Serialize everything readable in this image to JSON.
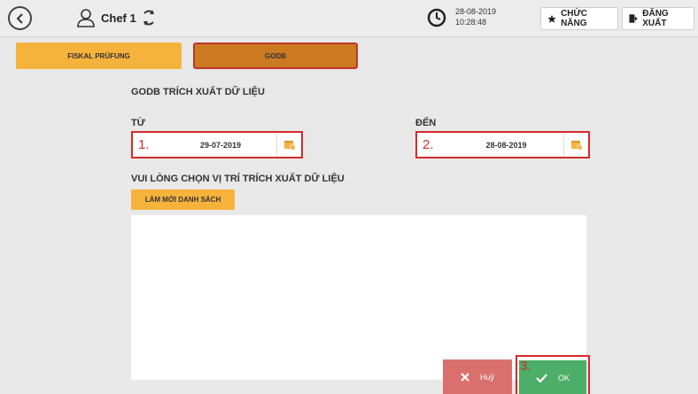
{
  "header": {
    "user_name": "Chef 1",
    "date": "28-08-2019",
    "time": "10:28:48",
    "functions_label": "CHỨC NĂNG",
    "logout_label": "ĐĂNG XUẤT"
  },
  "tabs": [
    {
      "label": "FISKAL PRÜFUNG",
      "active": false
    },
    {
      "label": "GODB",
      "active": true
    }
  ],
  "main": {
    "title": "GODB TRÍCH XUẤT DỮ LIỆU",
    "from_label": "TỪ",
    "to_label": "ĐẾN",
    "from_marker": "1.",
    "from_value": "29-07-2019",
    "to_marker": "2.",
    "to_value": "28-08-2019",
    "location_label": "VUI LÒNG CHỌN VỊ TRÍ TRÍCH XUẤT DỮ LIỆU",
    "refresh_label": "LÀM MỚI DANH SÁCH"
  },
  "footer": {
    "cancel_label": "Huỷ",
    "ok_label": "OK",
    "ok_marker": "3."
  },
  "colors": {
    "accent_orange": "#f6b33c",
    "active_tab": "#cc7a22",
    "cancel": "#d9706d",
    "ok": "#4cae68",
    "highlight_red": "#d42a2a"
  },
  "icons": [
    "back-icon",
    "user-icon",
    "sync-icon",
    "clock-icon",
    "star-icon",
    "logout-icon",
    "calendar-icon",
    "close-icon",
    "check-icon"
  ]
}
